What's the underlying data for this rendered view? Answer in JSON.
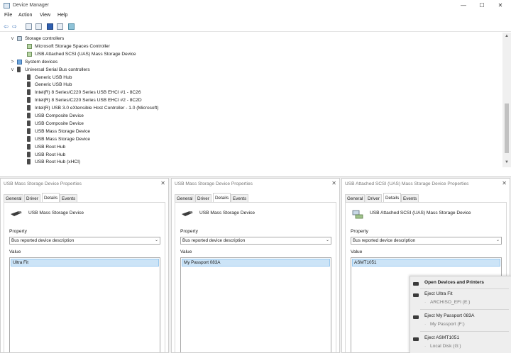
{
  "window": {
    "title": "Device Manager",
    "controls": {
      "minimize": "—",
      "maximize": "☐",
      "close": "✕"
    }
  },
  "menubar": [
    "File",
    "Action",
    "View",
    "Help"
  ],
  "toolbar": {
    "back": "⇦",
    "forward": "⇨"
  },
  "tree": [
    {
      "label": "Storage controllers",
      "chevron": "v",
      "icon": "storage-icon",
      "level": 0
    },
    {
      "label": "Microsoft Storage Spaces Controller",
      "icon": "controller-icon",
      "level": 1
    },
    {
      "label": "USB Attached SCSI (UAS) Mass Storage Device",
      "icon": "controller-icon",
      "level": 1
    },
    {
      "label": "System devices",
      "chevron": ">",
      "icon": "system-icon",
      "level": 0
    },
    {
      "label": "Universal Serial Bus controllers",
      "chevron": "v",
      "icon": "usb-icon",
      "level": 0
    },
    {
      "label": "Generic USB Hub",
      "icon": "usb-icon",
      "level": 1
    },
    {
      "label": "Generic USB Hub",
      "icon": "usb-icon",
      "level": 1
    },
    {
      "label": "Intel(R) 8 Series/C220 Series USB EHCI #1 - 8C26",
      "icon": "usb-icon",
      "level": 1
    },
    {
      "label": "Intel(R) 8 Series/C220 Series USB EHCI #2 - 8C2D",
      "icon": "usb-icon",
      "level": 1
    },
    {
      "label": "Intel(R) USB 3.0 eXtensible Host Controller - 1.0 (Microsoft)",
      "icon": "usb-icon",
      "level": 1
    },
    {
      "label": "USB Composite Device",
      "icon": "usb-icon",
      "level": 1
    },
    {
      "label": "USB Composite Device",
      "icon": "usb-icon",
      "level": 1
    },
    {
      "label": "USB Mass Storage Device",
      "icon": "usb-icon",
      "level": 1
    },
    {
      "label": "USB Mass Storage Device",
      "icon": "usb-icon",
      "level": 1
    },
    {
      "label": "USB Root Hub",
      "icon": "usb-icon",
      "level": 1
    },
    {
      "label": "USB Root Hub",
      "icon": "usb-icon",
      "level": 1
    },
    {
      "label": "USB Root Hub (xHCI)",
      "icon": "usb-icon",
      "level": 1
    }
  ],
  "scrollbar": {
    "up": "▲",
    "down": "▼"
  },
  "property_windows": [
    {
      "title": "USB Mass Storage Device Properties",
      "close": "✕",
      "tabs": [
        "General",
        "Driver",
        "Details",
        "Events"
      ],
      "active_tab": "Details",
      "device_name": "USB Mass Storage Device",
      "device_icon": "usb-drive-icon",
      "property_label": "Property",
      "property_value": "Bus reported device description",
      "value_label": "Value",
      "value": "Ultra Fit"
    },
    {
      "title": "USB Mass Storage Device Properties",
      "close": "✕",
      "tabs": [
        "General",
        "Driver",
        "Details",
        "Events"
      ],
      "active_tab": "Details",
      "device_name": "USB Mass Storage Device",
      "device_icon": "usb-drive-icon",
      "property_label": "Property",
      "property_value": "Bus reported device description",
      "value_label": "Value",
      "value": "My Passport 083A"
    },
    {
      "title": "USB Attached SCSI (UAS) Mass Storage Device Properties",
      "close": "✕",
      "tabs": [
        "General",
        "Driver",
        "Details",
        "Events"
      ],
      "active_tab": "Details",
      "device_name": "USB Attached SCSI (UAS) Mass Storage Device",
      "device_icon": "storage-controller-icon",
      "property_label": "Property",
      "property_value": "Bus reported device description",
      "value_label": "Value",
      "value": "ASMT1051"
    }
  ],
  "context_menu": {
    "items": [
      {
        "label": "Open Devices and Printers",
        "bold": true,
        "icon": "printer-icon",
        "kind": "action"
      },
      {
        "label": "Eject Ultra Fit",
        "icon": "usb-drive-icon",
        "kind": "action"
      },
      {
        "label": "ARCHISO_EFI (E:)",
        "kind": "sub"
      },
      {
        "label": "Eject My Passport 083A",
        "icon": "usb-drive-icon",
        "kind": "action"
      },
      {
        "label": "My Passport (F:)",
        "kind": "sub"
      },
      {
        "label": "Eject ASMT1051",
        "icon": "usb-drive-icon",
        "kind": "action"
      },
      {
        "label": "Local Disk (G:)",
        "kind": "sub"
      }
    ]
  }
}
